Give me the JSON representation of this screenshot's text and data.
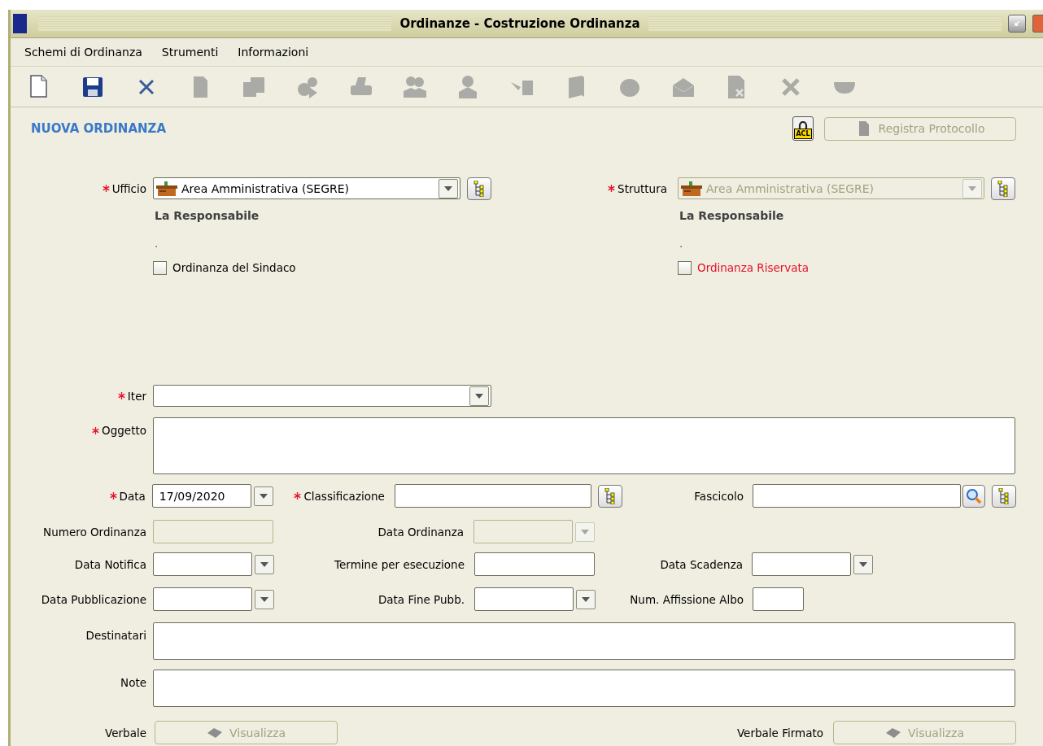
{
  "window": {
    "title": "Ordinanze - Costruzione Ordinanza"
  },
  "menu": [
    "Schemi di Ordinanza",
    "Strumenti",
    "Informazioni"
  ],
  "toolbar": [
    {
      "disabled": false
    },
    {
      "disabled": false
    },
    {
      "disabled": false
    },
    {
      "disabled": true
    },
    {
      "disabled": true
    },
    {
      "disabled": true
    },
    {
      "disabled": true
    },
    {
      "disabled": true
    },
    {
      "disabled": true
    },
    {
      "disabled": true
    },
    {
      "disabled": true
    },
    {
      "disabled": true
    },
    {
      "disabled": true
    },
    {
      "disabled": true
    },
    {
      "disabled": true
    },
    {
      "disabled": true
    }
  ],
  "heading": "NUOVA ORDINANZA",
  "acl_button": {
    "label": "ACL"
  },
  "registra_button": {
    "label": "Registra Protocollo",
    "disabled": true
  },
  "ufficio": {
    "label": "Ufficio",
    "required": true,
    "value": "Area Amministrativa (SEGRE)",
    "disabled": false,
    "responsabile": "La Responsabile",
    "detail": "."
  },
  "struttura": {
    "label": "Struttura",
    "required": true,
    "value": "Area Amministrativa (SEGRE)",
    "disabled": true,
    "responsabile": "La Responsabile",
    "detail": "."
  },
  "checkboxes": [
    {
      "label": "Ordinanza del Sindaco",
      "checked": false,
      "color": "#000000"
    },
    {
      "label": "Ordinanza Riservata",
      "checked": false,
      "color": "#e8102a"
    }
  ],
  "iter": {
    "label": "Iter",
    "required": true
  },
  "oggetto": {
    "label": "Oggetto",
    "required": true
  },
  "data": {
    "label": "Data",
    "required": true,
    "value": "17/09/2020"
  },
  "classificazione": {
    "label": "Classificazione",
    "required": true
  },
  "fascicolo": {
    "label": "Fascicolo"
  },
  "numero_ordinanza": {
    "label": "Numero Ordinanza",
    "disabled": true
  },
  "data_ordinanza": {
    "label": "Data Ordinanza",
    "disabled": true
  },
  "data_notifica": {
    "label": "Data Notifica",
    "disabled": false
  },
  "termine_esecuzione": {
    "label": "Termine per esecuzione"
  },
  "data_scadenza": {
    "label": "Data Scadenza",
    "disabled": false
  },
  "data_pubblicazione": {
    "label": "Data Pubblicazione",
    "disabled": false
  },
  "data_fine_pubb": {
    "label": "Data Fine Pubb.",
    "disabled": false
  },
  "num_affissione_albo": {
    "label": "Num. Affissione Albo"
  },
  "destinatari": {
    "label": "Destinatari"
  },
  "note": {
    "label": "Note"
  },
  "verbale": {
    "label": "Verbale",
    "button": "Visualizza",
    "disabled": true
  },
  "verbale_firmato": {
    "label": "Verbale Firmato",
    "button": "Visualizza",
    "disabled": true
  }
}
